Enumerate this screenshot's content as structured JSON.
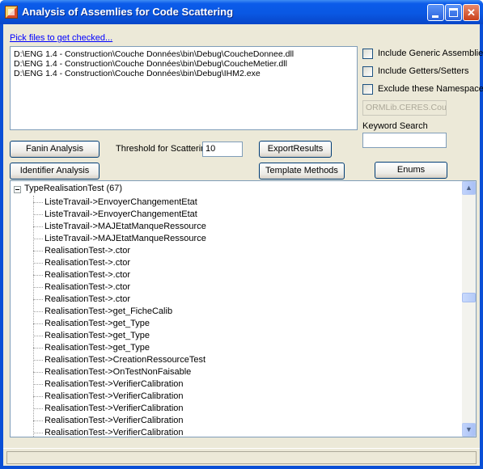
{
  "window": {
    "title": "Analysis of Assemlies for Code Scattering",
    "minimize": "",
    "maximize": "",
    "close": "✕"
  },
  "files": {
    "link_label": "Pick files to get checked...",
    "items": [
      "D:\\ENG 1.4 - Construction\\Couche Données\\bin\\Debug\\CoucheDonnee.dll",
      "D:\\ENG 1.4 - Construction\\Couche Données\\bin\\Debug\\CoucheMetier.dll",
      "D:\\ENG 1.4 - Construction\\Couche Données\\bin\\Debug\\IHM2.exe"
    ]
  },
  "options": {
    "include_generic": {
      "label": "Include Generic Assemblies",
      "checked": false
    },
    "include_getters": {
      "label": "Include Getters/Setters",
      "checked": false
    },
    "exclude_namespaces": {
      "label": "Exclude these Namespaces",
      "checked": false
    },
    "namespace_value": "ORMLib.CERES.Couc",
    "keyword_label": "Keyword Search",
    "keyword_value": ""
  },
  "toolbar": {
    "fanin_label": "Fanin Analysis",
    "threshold_label": "Threshold for Scattering",
    "threshold_value": "10",
    "export_label": "ExportResults",
    "identifier_label": "Identifier Analysis",
    "template_label": "Template Methods",
    "enums_label": "Enums"
  },
  "tree": {
    "root_label": "TypeRealisationTest (67)",
    "items": [
      "ListeTravail->EnvoyerChangementEtat",
      "ListeTravail->EnvoyerChangementEtat",
      "ListeTravail->MAJEtatManqueRessource",
      "ListeTravail->MAJEtatManqueRessource",
      "RealisationTest->.ctor",
      "RealisationTest->.ctor",
      "RealisationTest->.ctor",
      "RealisationTest->.ctor",
      "RealisationTest->.ctor",
      "RealisationTest->get_FicheCalib",
      "RealisationTest->get_Type",
      "RealisationTest->get_Type",
      "RealisationTest->get_Type",
      "RealisationTest->CreationRessourceTest",
      "RealisationTest->OnTestNonFaisable",
      "RealisationTest->VerifierCalibration",
      "RealisationTest->VerifierCalibration",
      "RealisationTest->VerifierCalibration",
      "RealisationTest->VerifierCalibration",
      "RealisationTest->VerifierCalibration"
    ]
  },
  "colors": {
    "titlebar": "#0a58e3",
    "client": "#ece9d8",
    "link": "#0000ff"
  },
  "status": {
    "text": ""
  }
}
